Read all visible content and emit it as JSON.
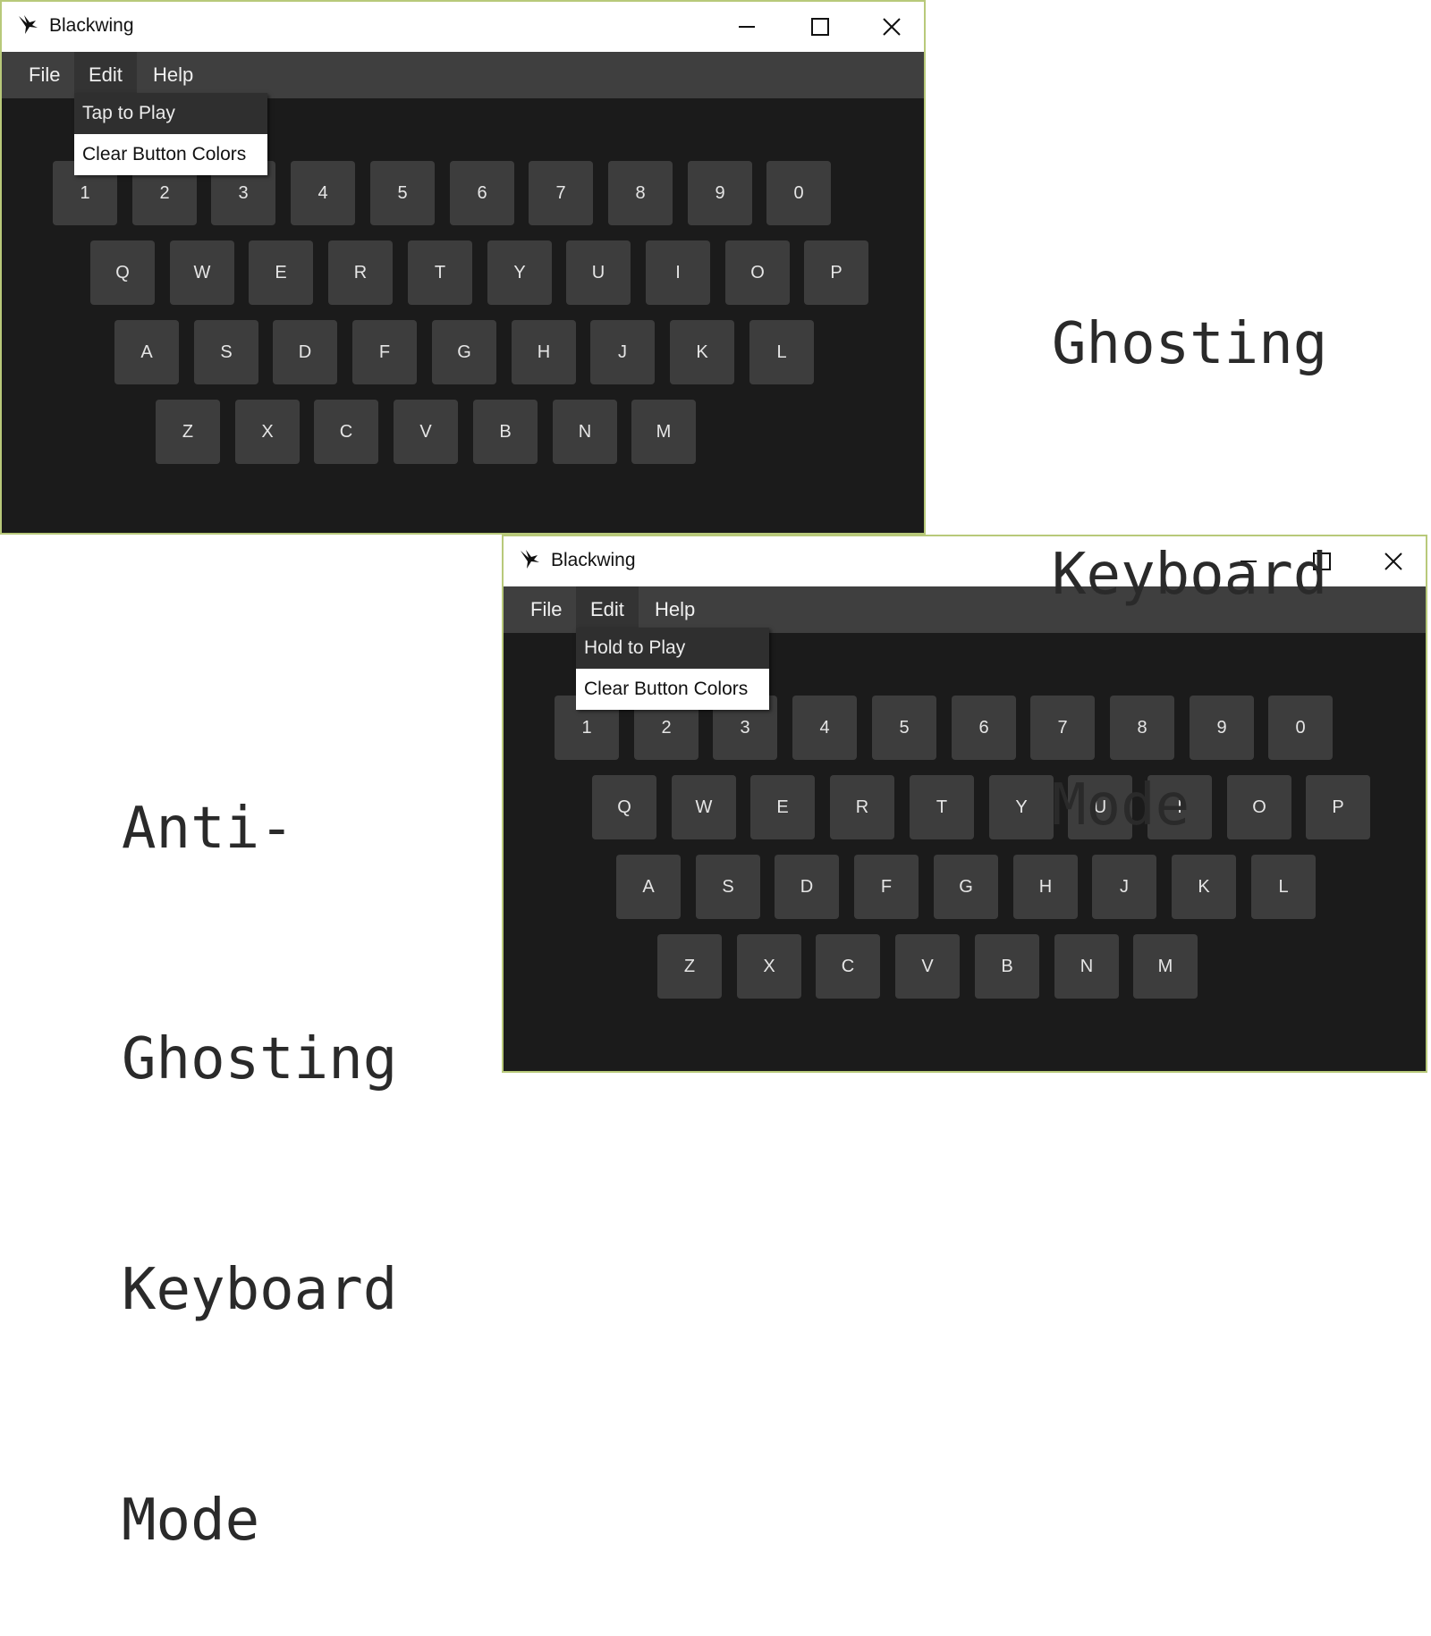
{
  "app": {
    "title": "Blackwing"
  },
  "windows": [
    {
      "menu": [
        "File",
        "Edit",
        "Help"
      ],
      "dropdown": [
        "Tap to Play",
        "Clear Button Colors"
      ],
      "caption": [
        "Ghosting",
        "Keyboard",
        "Mode"
      ]
    },
    {
      "menu": [
        "File",
        "Edit",
        "Help"
      ],
      "dropdown": [
        "Hold to Play",
        "Clear Button Colors"
      ],
      "caption": [
        "Anti-",
        "Ghosting",
        "Keyboard",
        "Mode"
      ]
    }
  ],
  "keyboard": {
    "rows": [
      [
        "1",
        "2",
        "3",
        "4",
        "5",
        "6",
        "7",
        "8",
        "9",
        "0"
      ],
      [
        "Q",
        "W",
        "E",
        "R",
        "T",
        "Y",
        "U",
        "I",
        "O",
        "P"
      ],
      [
        "A",
        "S",
        "D",
        "F",
        "G",
        "H",
        "J",
        "K",
        "L"
      ],
      [
        "Z",
        "X",
        "C",
        "V",
        "B",
        "N",
        "M"
      ]
    ]
  },
  "colors": {
    "window_border": "#b8c97a",
    "window_bg": "#1b1b1b",
    "menubar": "#3f3f3f",
    "key": "#3d3d3d"
  }
}
